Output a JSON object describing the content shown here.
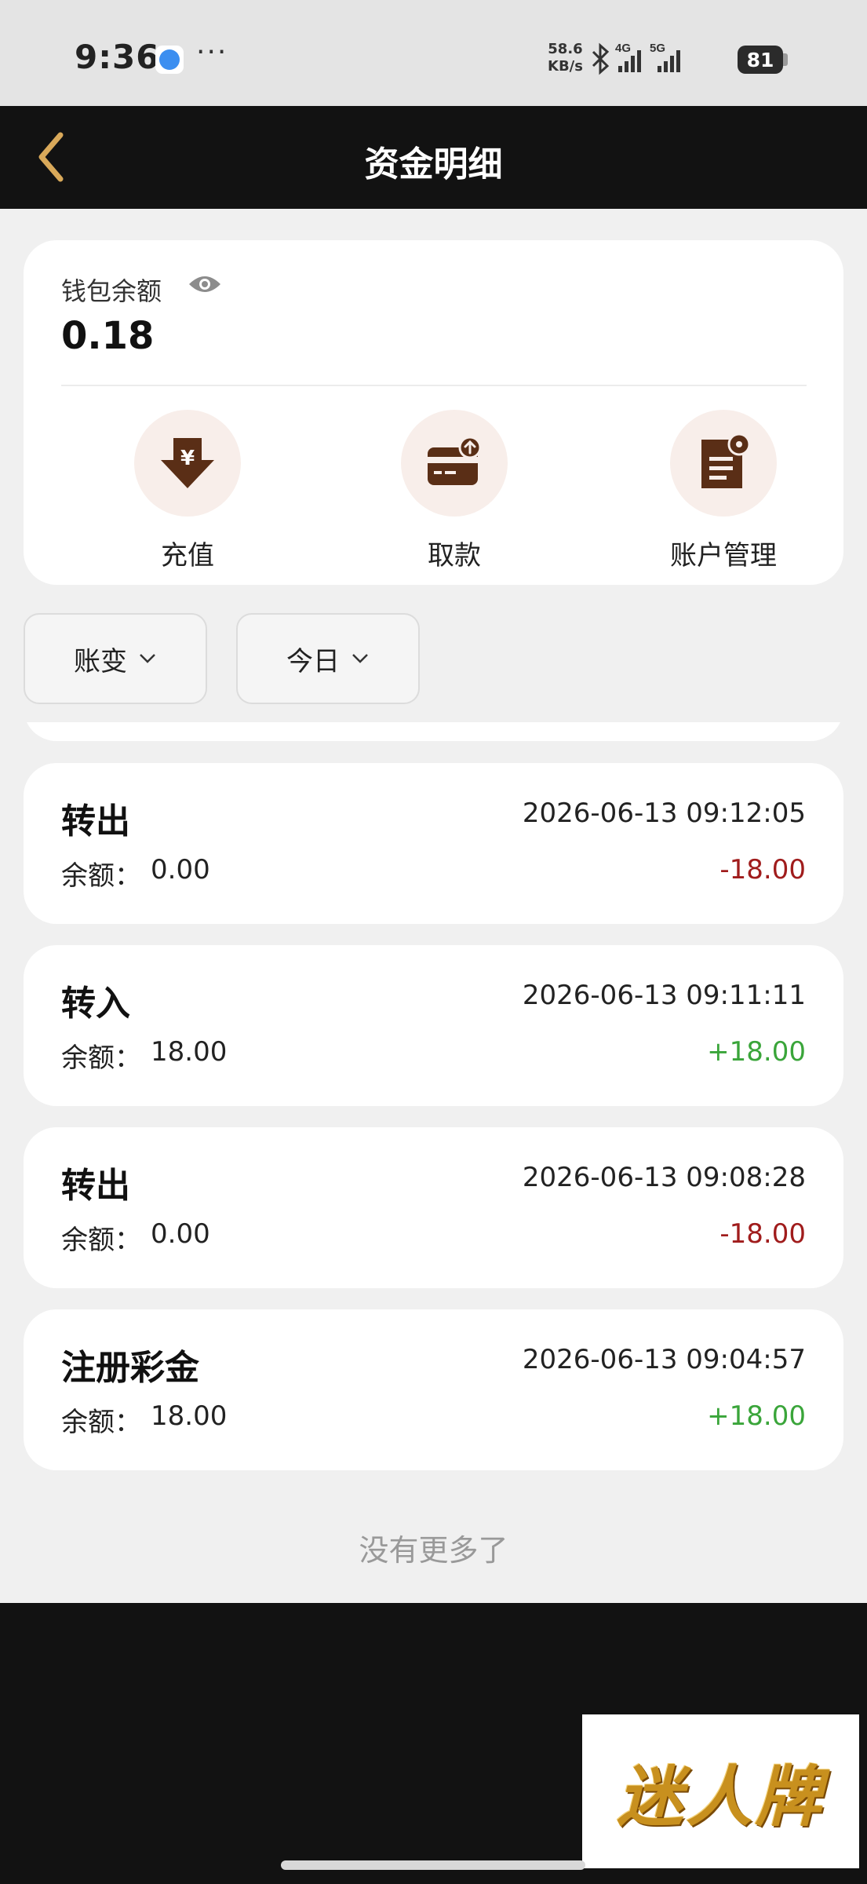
{
  "status_bar": {
    "time": "9:36",
    "dots": "···",
    "net_speed_value": "58.6",
    "net_speed_unit": "KB/s",
    "signal_1": "4G",
    "signal_2": "5G",
    "battery": "81"
  },
  "header": {
    "title": "资金明细",
    "back_icon": "chevron-left-icon"
  },
  "wallet": {
    "label": "钱包余额",
    "eye_icon": "eye-icon",
    "balance": "0.18",
    "actions": [
      {
        "label": "充值",
        "icon": "yuan-download-icon"
      },
      {
        "label": "取款",
        "icon": "card-withdraw-icon"
      },
      {
        "label": "账户管理",
        "icon": "doc-gear-icon"
      }
    ]
  },
  "filters": [
    {
      "label": "账变"
    },
    {
      "label": "今日"
    }
  ],
  "transactions": [
    {
      "type": "转出",
      "time": "2026-06-13 09:12:05",
      "balance_label": "余额：",
      "balance": "0.00",
      "amount": "-18.00"
    },
    {
      "type": "转入",
      "time": "2026-06-13 09:11:11",
      "balance_label": "余额：",
      "balance": "18.00",
      "amount": "+18.00"
    },
    {
      "type": "转出",
      "time": "2026-06-13 09:08:28",
      "balance_label": "余额：",
      "balance": "0.00",
      "amount": "-18.00"
    },
    {
      "type": "注册彩金",
      "time": "2026-06-13 09:04:57",
      "balance_label": "余额：",
      "balance": "18.00",
      "amount": "+18.00"
    }
  ],
  "no_more": "没有更多了",
  "watermark": "迷人牌",
  "colors": {
    "accent_brown": "#5a2e16",
    "negative": "#a01c1c",
    "positive": "#3aa53a",
    "header_bg": "#121212",
    "back_gold": "#d9a95a"
  }
}
